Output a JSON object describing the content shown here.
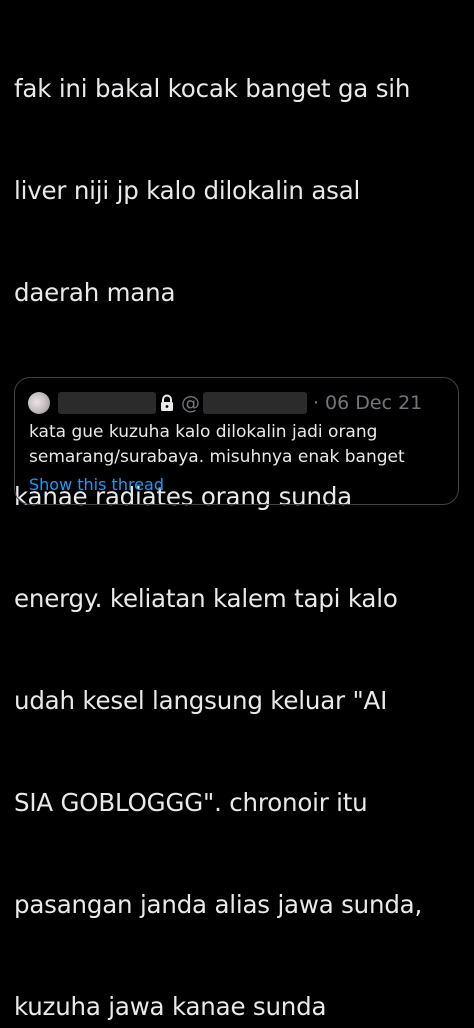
{
  "tweet": {
    "lines_para1": [
      "fak ini bakal kocak banget ga sih",
      "liver niji jp kalo dilokalin asal",
      "daerah mana"
    ],
    "lines_para2": [
      "kanae radiates orang sunda",
      "energy. keliatan kalem tapi kalo",
      "udah kesel langsung keluar \"AI",
      "SIA GOBLOGGG\". chronoir itu",
      "pasangan janda alias jawa sunda,",
      "kuzuha jawa kanae sunda"
    ]
  },
  "quote": {
    "at_symbol": "@",
    "separator": "·",
    "date": "06 Dec 21",
    "text_lines": [
      "kata gue kuzuha kalo dilokalin jadi orang",
      "semarang/surabaya. misuhnya enak banget"
    ],
    "show_thread_label": "Show this thread",
    "icons": {
      "lock": "lock-icon",
      "avatar": "avatar"
    }
  },
  "colors": {
    "background": "#000000",
    "text": "#e7e9ea",
    "secondary_text": "#71767b",
    "link": "#1d9bf0",
    "border": "#3e4144"
  }
}
